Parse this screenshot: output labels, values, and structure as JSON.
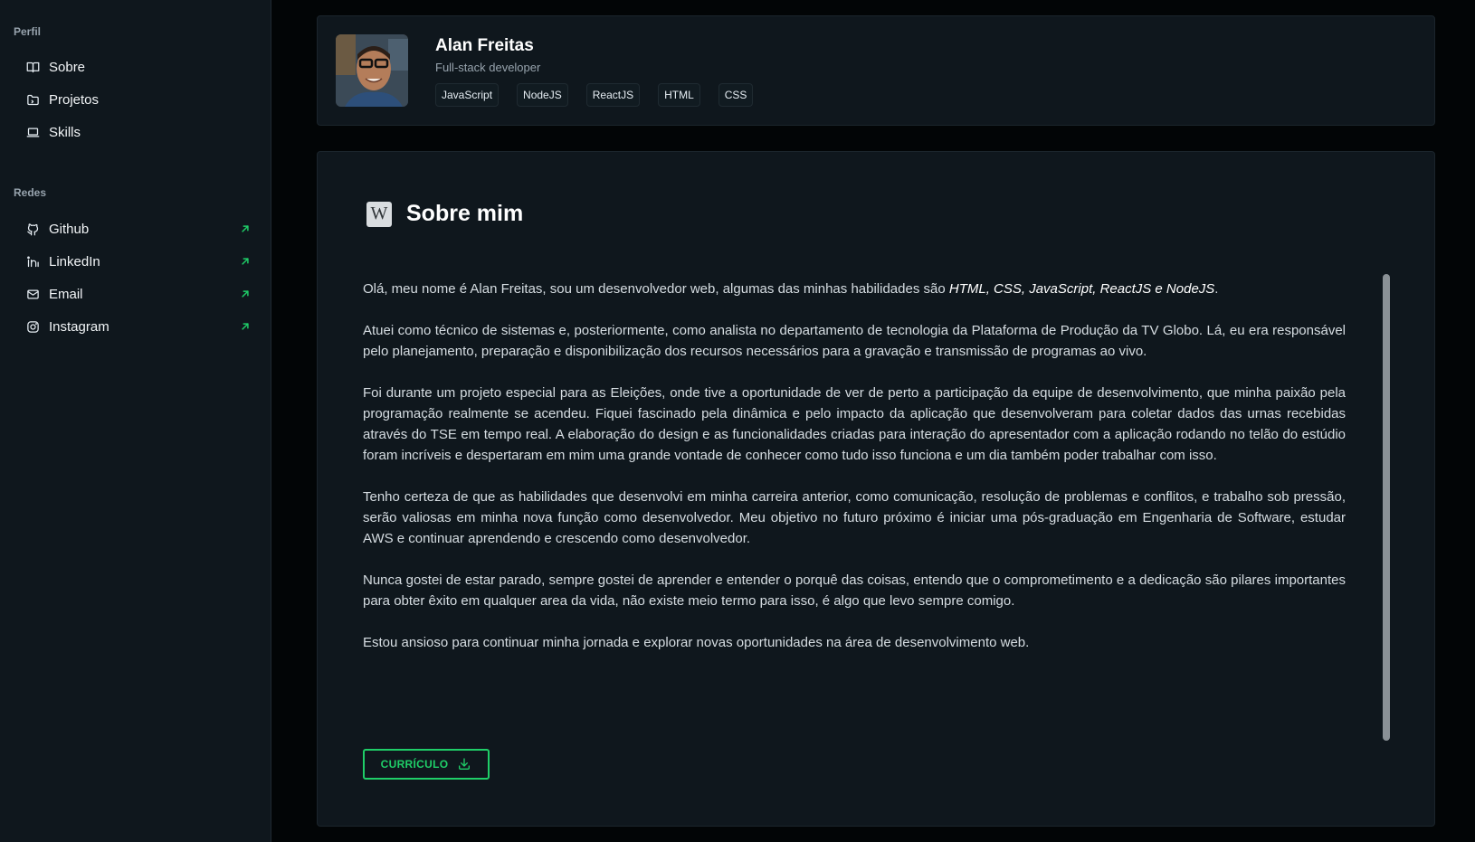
{
  "sidebar": {
    "profile_section": "Perfil",
    "profile_items": [
      {
        "label": "Sobre",
        "icon": "book-open-icon"
      },
      {
        "label": "Projetos",
        "icon": "folder-icon"
      },
      {
        "label": "Skills",
        "icon": "laptop-icon"
      }
    ],
    "networks_section": "Redes",
    "network_items": [
      {
        "label": "Github",
        "icon": "github-icon"
      },
      {
        "label": "LinkedIn",
        "icon": "linkedin-icon"
      },
      {
        "label": "Email",
        "icon": "mail-icon"
      },
      {
        "label": "Instagram",
        "icon": "instagram-icon"
      }
    ],
    "external_link_icon": "arrow-up-right-icon"
  },
  "profile": {
    "name": "Alan Freitas",
    "role": "Full-stack developer",
    "tags": [
      "JavaScript",
      "NodeJS",
      "ReactJS",
      "HTML",
      "CSS"
    ]
  },
  "about": {
    "title": "Sobre mim",
    "icon": "wikipedia-icon",
    "intro_prefix": "Olá, meu nome é Alan Freitas, sou um desenvolvedor web, algumas das minhas habilidades são ",
    "intro_skills": "HTML, CSS, JavaScript, ReactJS e NodeJS",
    "intro_suffix": ".",
    "paragraphs": [
      "Atuei como técnico de sistemas e, posteriormente, como analista no departamento de tecnologia da Plataforma de Produção da TV Globo. Lá, eu era responsável pelo planejamento, preparação e disponibilização dos recursos necessários para a gravação e transmissão de programas ao vivo.",
      "Foi durante um projeto especial para as Eleições, onde tive a oportunidade de ver de perto a participação da equipe de desenvolvimento, que minha paixão pela programação realmente se acendeu. Fiquei fascinado pela dinâmica e pelo impacto da aplicação que desenvolveram para coletar dados das urnas recebidas através do TSE em tempo real. A elaboração do design e as funcionalidades criadas para interação do apresentador com a aplicação rodando no telão do estúdio foram incríveis e despertaram em mim uma grande vontade de conhecer como tudo isso funciona e um dia também poder trabalhar com isso.",
      "Tenho certeza de que as habilidades que desenvolvi em minha carreira anterior, como comunicação, resolução de problemas e conflitos, e trabalho sob pressão, serão valiosas em minha nova função como desenvolvedor. Meu objetivo no futuro próximo é iniciar uma pós-graduação em Engenharia de Software, estudar AWS e continuar aprendendo e crescendo como desenvolvedor.",
      "Nunca gostei de estar parado, sempre gostei de aprender e entender o porquê das coisas, entendo que o comprometimento e a dedicação são pilares importantes para obter êxito em qualquer area da vida, não existe meio termo para isso, é algo que levo sempre comigo.",
      "Estou ansioso para continuar minha jornada e explorar novas oportunidades na área de desenvolvimento web."
    ],
    "cv_button": "CURRÍCULO",
    "cv_icon": "download-icon"
  },
  "colors": {
    "accent": "#1fce68",
    "sidebar_bg": "#0f171d",
    "page_bg": "#020506"
  }
}
